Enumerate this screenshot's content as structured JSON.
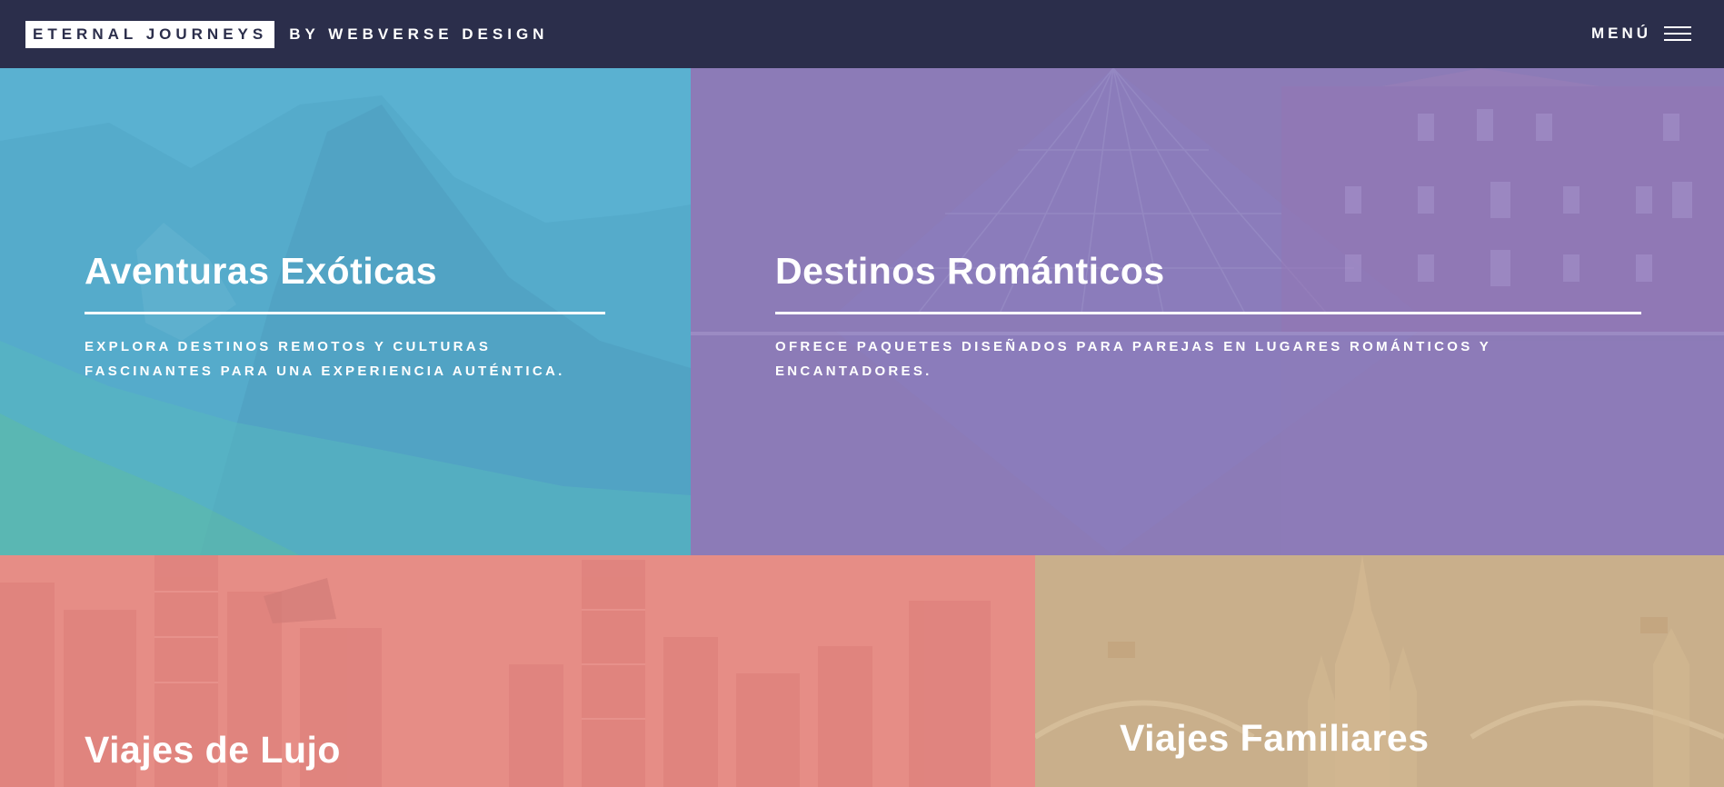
{
  "header": {
    "brand_name": "ETERNAL JOURNEYS",
    "brand_byline": "BY WEBVERSE DESIGN",
    "menu_label": "MENÚ",
    "menu_icon": "hamburger-icon"
  },
  "tiles": [
    {
      "title": "Aventuras Exóticas",
      "description": "EXPLORA DESTINOS REMOTOS Y CULTURAS FASCINANTES PARA UNA EXPERIENCIA AUTÉNTICA.",
      "color": "#5ab1d1"
    },
    {
      "title": "Destinos Románticos",
      "description": "OFRECE PAQUETES DISEÑADOS PARA PAREJAS EN LUGARES ROMÁNTICOS Y ENCANTADORES.",
      "color": "#8c7bb7"
    },
    {
      "title": "Viajes de Lujo",
      "color": "#e68d86"
    },
    {
      "title": "Viajes Familiares",
      "color": "#c9af8b"
    }
  ]
}
